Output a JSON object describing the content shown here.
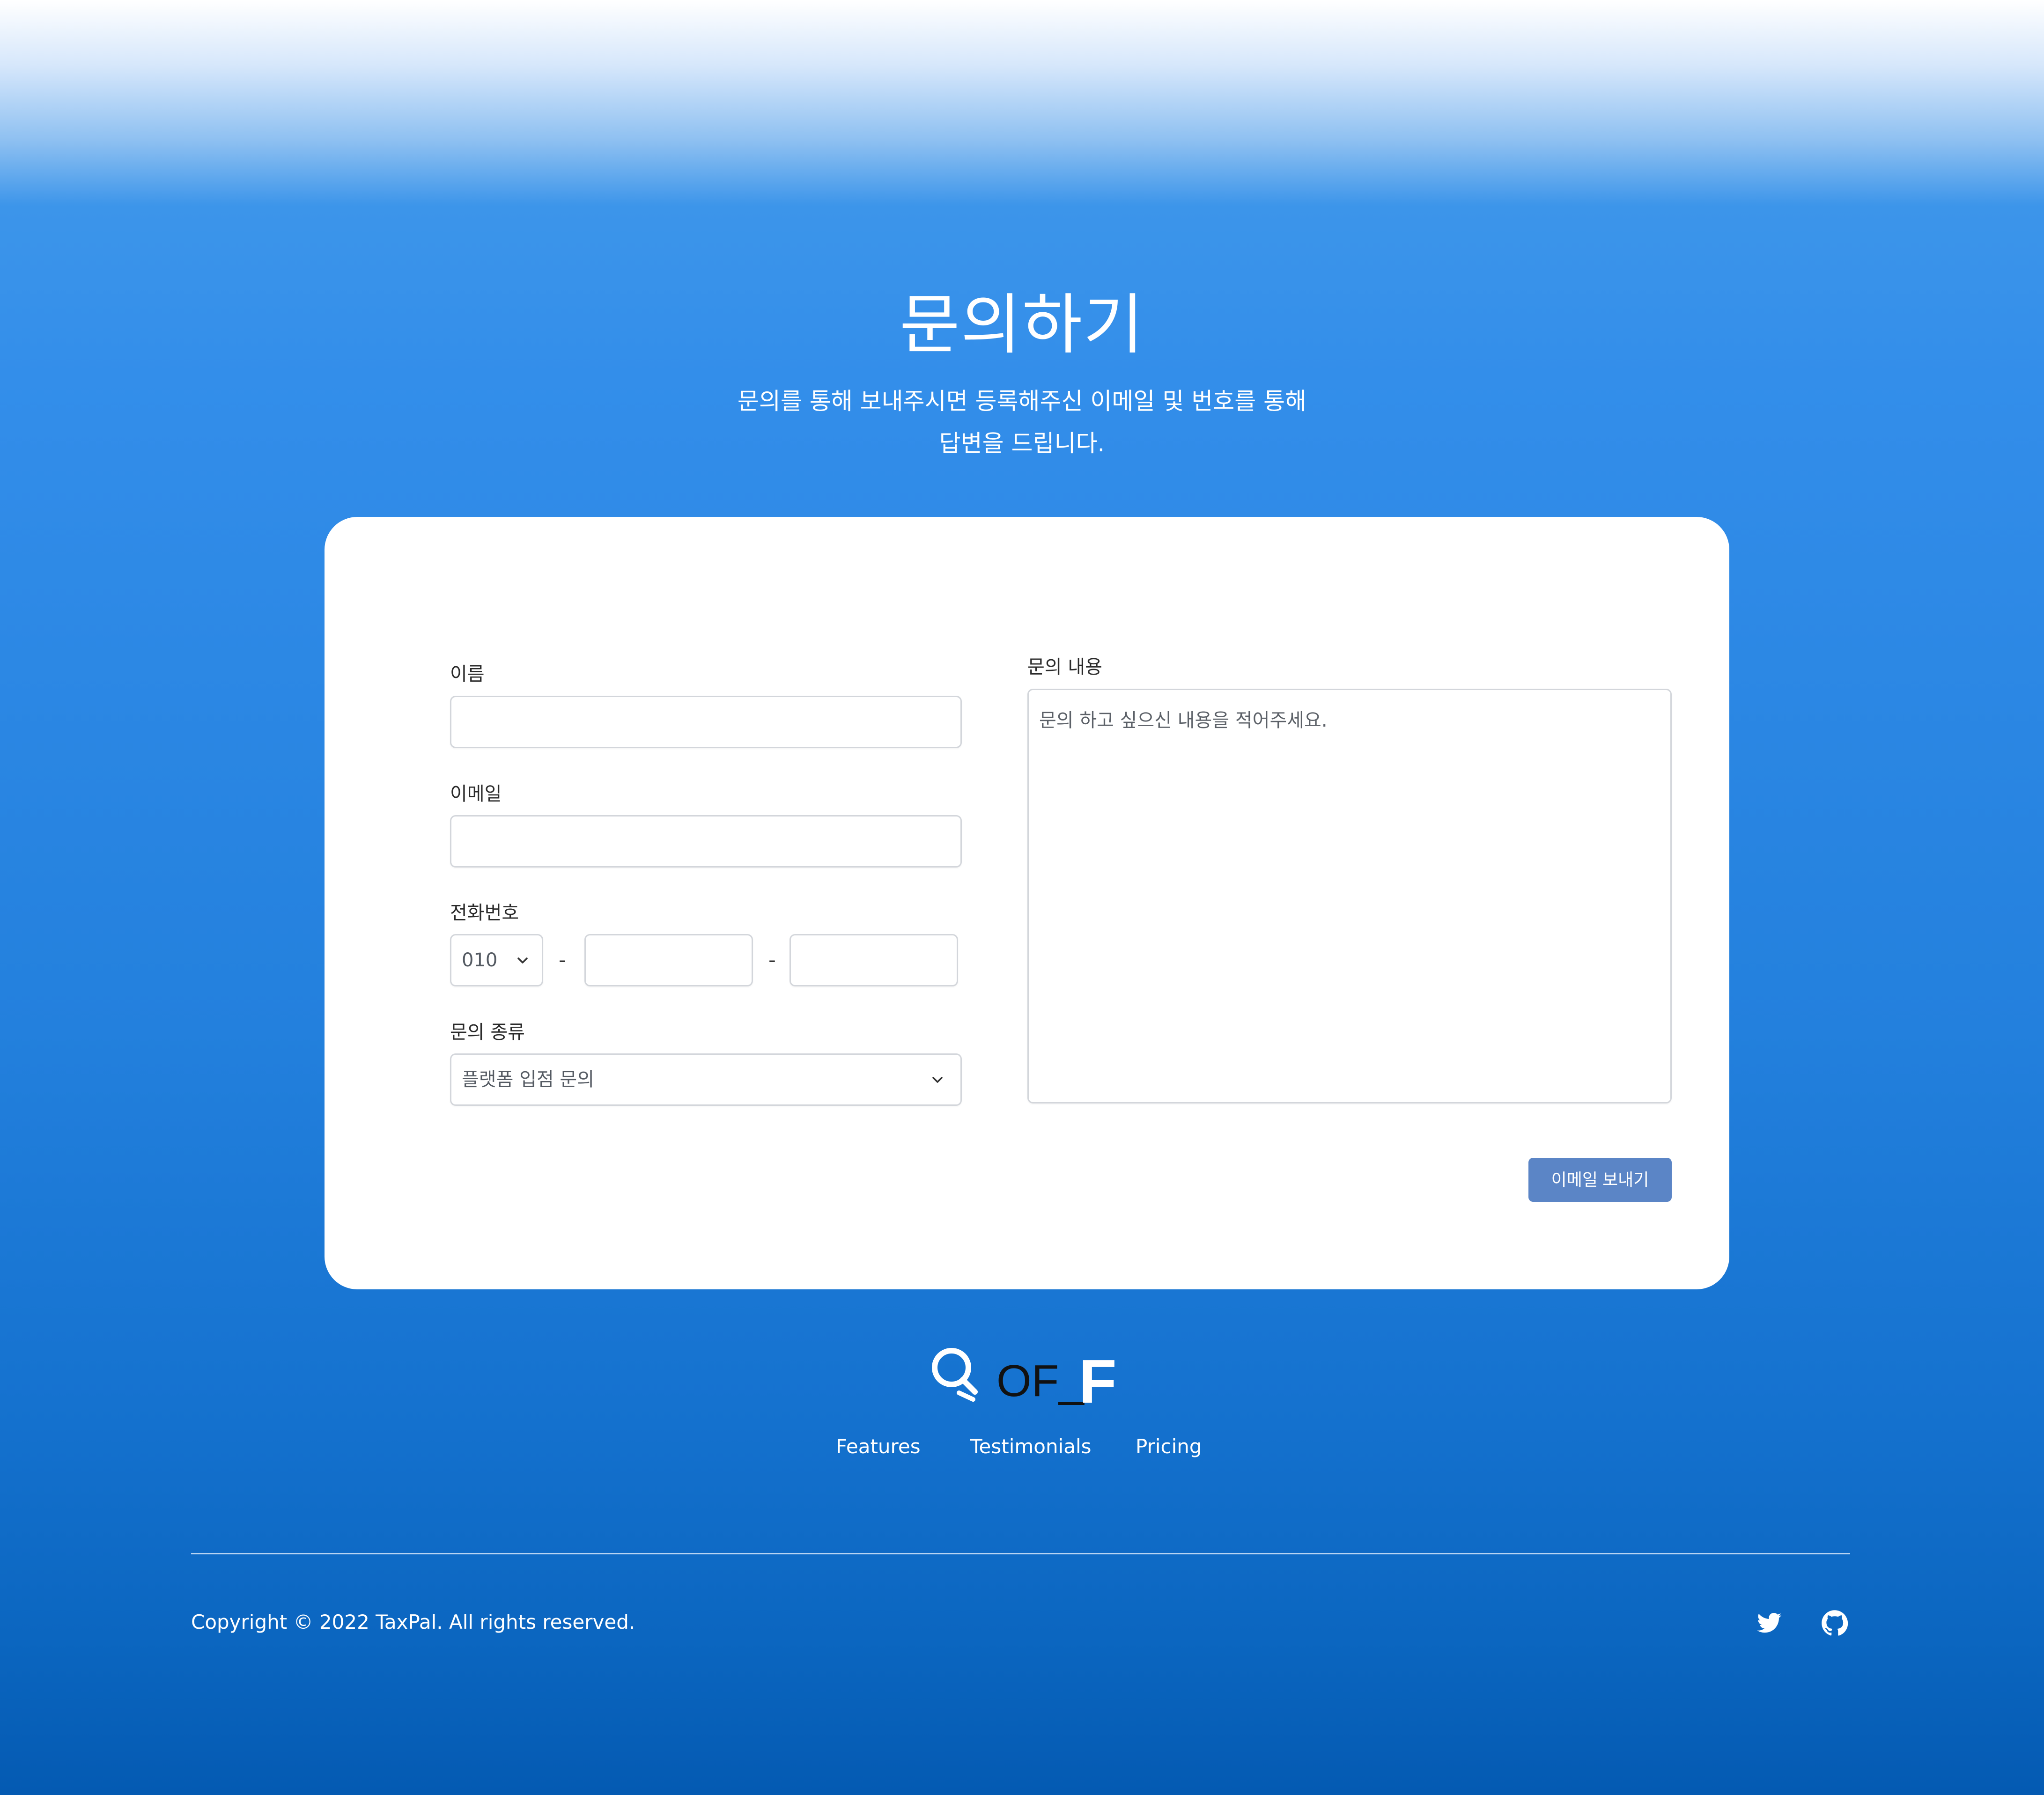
{
  "header": {
    "title": "문의하기",
    "subtitle_line1": "문의를 통해 보내주시면 등록해주신 이메일 및 번호를 통해",
    "subtitle_line2": "답변을 드립니다."
  },
  "form": {
    "name_label": "이름",
    "name_value": "",
    "email_label": "이메일",
    "email_value": "",
    "phone_label": "전화번호",
    "phone_prefix": "010",
    "phone_separator": "-",
    "phone_middle": "",
    "phone_last": "",
    "type_label": "문의 종류",
    "type_selected": "플랫폼 입점 문의",
    "content_label": "문의 내용",
    "content_placeholder": "문의 하고 싶으신 내용을 적어주세요.",
    "submit_label": "이메일 보내기"
  },
  "footer": {
    "logo_text": "OF_",
    "logo_letter": "F",
    "nav": [
      "Features",
      "Testimonials",
      "Pricing"
    ],
    "copyright": "Copyright © 2022 TaxPal. All rights reserved.",
    "social_icons": [
      "twitter-icon",
      "github-icon"
    ]
  },
  "colors": {
    "button": "#5b85c6",
    "background_blue": "#338eea",
    "background_dark_blue": "#045ab2"
  }
}
